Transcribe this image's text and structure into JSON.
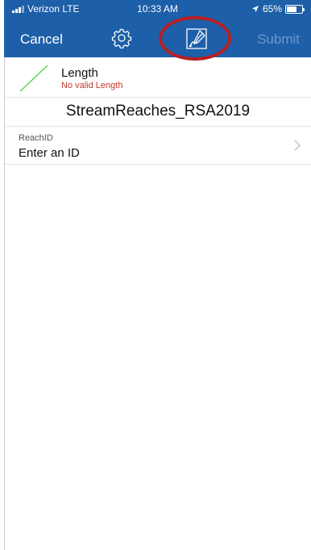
{
  "status_bar": {
    "carrier": "Verizon LTE",
    "time": "10:33 AM",
    "battery": "65%",
    "battery_level": 0.65
  },
  "nav": {
    "cancel_label": "Cancel",
    "submit_label": "Submit",
    "settings_icon": "gear-icon",
    "sketch_icon": "sketch-edit-icon"
  },
  "geometry": {
    "title": "Length",
    "status": "No valid Length",
    "icon": "polyline-icon",
    "icon_color": "#53d94a"
  },
  "layer": {
    "name": "StreamReaches_RSA2019"
  },
  "fields": [
    {
      "label": "ReachID",
      "value": "Enter an ID"
    }
  ],
  "colors": {
    "nav_background": "#1d5fa8",
    "annotation_ring": "#b81e24",
    "error_text": "#c0392b"
  }
}
